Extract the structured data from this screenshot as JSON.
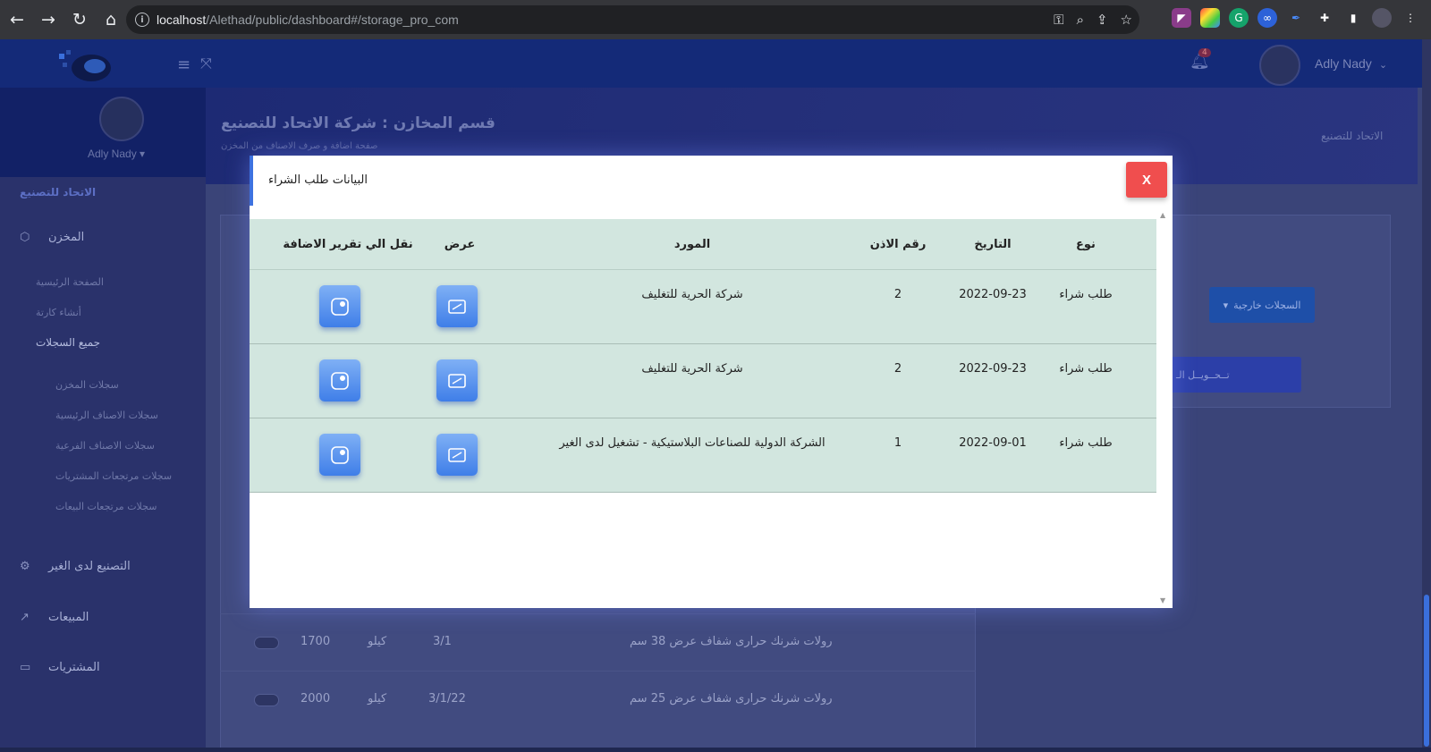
{
  "browser": {
    "url_host": "localhost",
    "url_path": "/Alethad/public/dashboard#/storage_pro_com"
  },
  "header": {
    "notification_count": "4",
    "user_name": "Adly Nady"
  },
  "sidebar": {
    "user_name": "Adly Nady",
    "brand": "الاتحاد للتصنيع",
    "sections": [
      {
        "label": "المخزن",
        "icon": "box-icon"
      },
      {
        "label": "التصنيع لدى الغير",
        "icon": "gear-icon"
      },
      {
        "label": "المبيعات",
        "icon": "chart-icon"
      },
      {
        "label": "المشتريات",
        "icon": "card-icon"
      }
    ],
    "links": [
      "الصفحة الرئيسية",
      "أنشاء كارتة",
      "جميع السجلات"
    ],
    "sublinks": [
      "سجلات المخزن",
      "سجلات الاصناف الرئيسية",
      "سجلات الاصناف الفرعية",
      "سجلات مرتجعات المشتريات",
      "سجلات مرتجعات البيعات"
    ]
  },
  "page": {
    "title": "قسم المخازن : شركة الاتحاد للتصنيع",
    "subtitle": "صفحة اضافة و صرف الاصناف من المخزن",
    "breadcrumb": "الاتحاد للتصنيع",
    "external_records_label": "السجلات خارجية",
    "transfer_label": "تــحــويــل الـ"
  },
  "background_rows": [
    {
      "name": "رولات شرنك حرارى شفاف عرض 38 سم",
      "date": "3/1",
      "unit": "كيلو",
      "qty": "1700"
    },
    {
      "name": "رولات شرنك حرارى شفاف عرض 25 سم",
      "date": "3/1/22",
      "unit": "كيلو",
      "qty": "2000"
    }
  ],
  "modal": {
    "title": "البيانات طلب الشراء",
    "close_label": "X",
    "columns": {
      "type": "نوع",
      "date": "التاريخ",
      "permit_no": "رقم الاذن",
      "supplier": "المورد",
      "view": "عرض",
      "transfer": "نقل الي تقرير الاضافة"
    },
    "rows": [
      {
        "type": "طلب شراء",
        "date": "2022-09-23",
        "permit_no": "2",
        "supplier": "شركة الحرية للتغليف"
      },
      {
        "type": "طلب شراء",
        "date": "2022-09-23",
        "permit_no": "2",
        "supplier": "شركة الحرية للتغليف"
      },
      {
        "type": "طلب شراء",
        "date": "2022-09-01",
        "permit_no": "1",
        "supplier": "الشركة الدولية للصناعات البلاستيكية - تشغيل لدى الغير"
      }
    ]
  },
  "colors": {
    "accent": "#3d72e0",
    "close_button": "#f04e4e",
    "table_row": "#d2e6df"
  }
}
